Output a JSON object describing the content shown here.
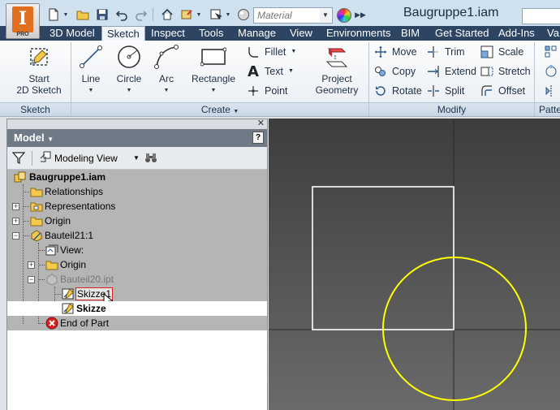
{
  "app": {
    "badge": "PRO",
    "logo_letter": "I"
  },
  "title": "Baugruppe1.iam",
  "quick_access": {
    "material_placeholder": "Material"
  },
  "tabs": [
    {
      "label": "3D Model"
    },
    {
      "label": "Sketch"
    },
    {
      "label": "Inspect"
    },
    {
      "label": "Tools"
    },
    {
      "label": "Manage"
    },
    {
      "label": "View"
    },
    {
      "label": "Environments"
    },
    {
      "label": "BIM"
    },
    {
      "label": "Get Started"
    },
    {
      "label": "Add-Ins"
    },
    {
      "label": "Va"
    }
  ],
  "active_tab": "Sketch",
  "ribbon": {
    "sketch_panel": {
      "label": "Sketch",
      "start_line1": "Start",
      "start_line2": "2D Sketch"
    },
    "create_panel": {
      "label": "Create",
      "line": "Line",
      "circle": "Circle",
      "arc": "Arc",
      "rectangle": "Rectangle",
      "fillet": "Fillet",
      "text": "Text",
      "point": "Point",
      "project_line1": "Project",
      "project_line2": "Geometry"
    },
    "modify_panel": {
      "label": "Modify",
      "move": "Move",
      "trim": "Trim",
      "scale": "Scale",
      "copy": "Copy",
      "extend": "Extend",
      "stretch": "Stretch",
      "rotate": "Rotate",
      "split": "Split",
      "offset": "Offset"
    },
    "pattern_panel": {
      "label": "Patte"
    }
  },
  "browser": {
    "title": "Model",
    "view_mode": "Modeling View",
    "tree": [
      {
        "label": "Baugruppe1.iam",
        "bold": true
      },
      {
        "label": "Relationships"
      },
      {
        "label": "Representations"
      },
      {
        "label": "Origin"
      },
      {
        "label": "Bauteil21:1"
      },
      {
        "label": "View:"
      },
      {
        "label": "Origin"
      },
      {
        "label": "Bauteil20.ipt",
        "dimmed": true
      },
      {
        "label": "Skizze1",
        "boxed": true
      },
      {
        "label": "Skizze",
        "bold": true
      },
      {
        "label": "End of Part"
      }
    ]
  },
  "colors": {
    "ribbon_tab_bar": "#2d4563",
    "sketch_circle": "#ffff00",
    "sketch_rectangle": "#ffffff",
    "viewport_top": "#3d3d3d",
    "viewport_bottom": "#6a6a6a",
    "end_of_part_icon": "#d92020"
  }
}
